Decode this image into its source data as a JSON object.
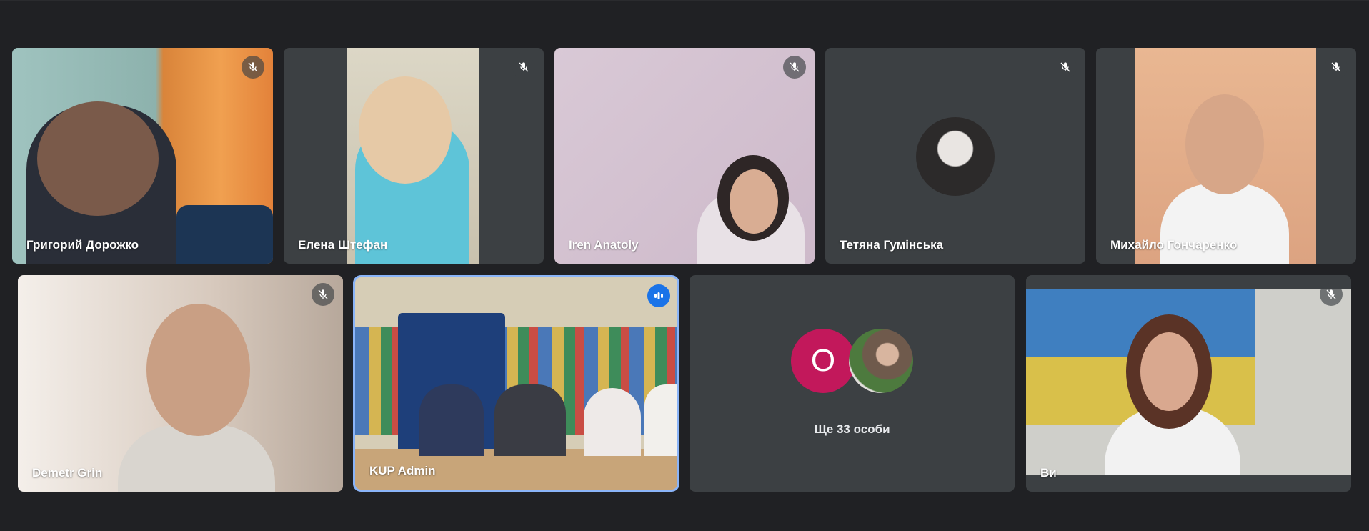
{
  "participants": [
    {
      "name": "Григорий Дорожко",
      "muted": true
    },
    {
      "name": "Елена Штефан",
      "muted": true
    },
    {
      "name": "Iren Anatoly",
      "muted": true
    },
    {
      "name": "Тетяна Гумінська",
      "muted": true
    },
    {
      "name": "Михайло Гончаренко",
      "muted": true
    },
    {
      "name": "Demetr Grin",
      "muted": true
    },
    {
      "name": "KUP Admin",
      "muted": false,
      "speaking": true
    },
    {
      "name": "Ви",
      "muted": true
    }
  ],
  "others": {
    "avatar_letter": "О",
    "label": "Ще 33 особи"
  },
  "icons": {
    "mute": "mic-off-icon",
    "speaking": "speaking-indicator-icon"
  },
  "colors": {
    "background": "#202124",
    "tile": "#3c4043",
    "active_border": "#8ab4f8",
    "speaking_badge": "#1a73e8",
    "letter_avatar": "#c2185b"
  }
}
